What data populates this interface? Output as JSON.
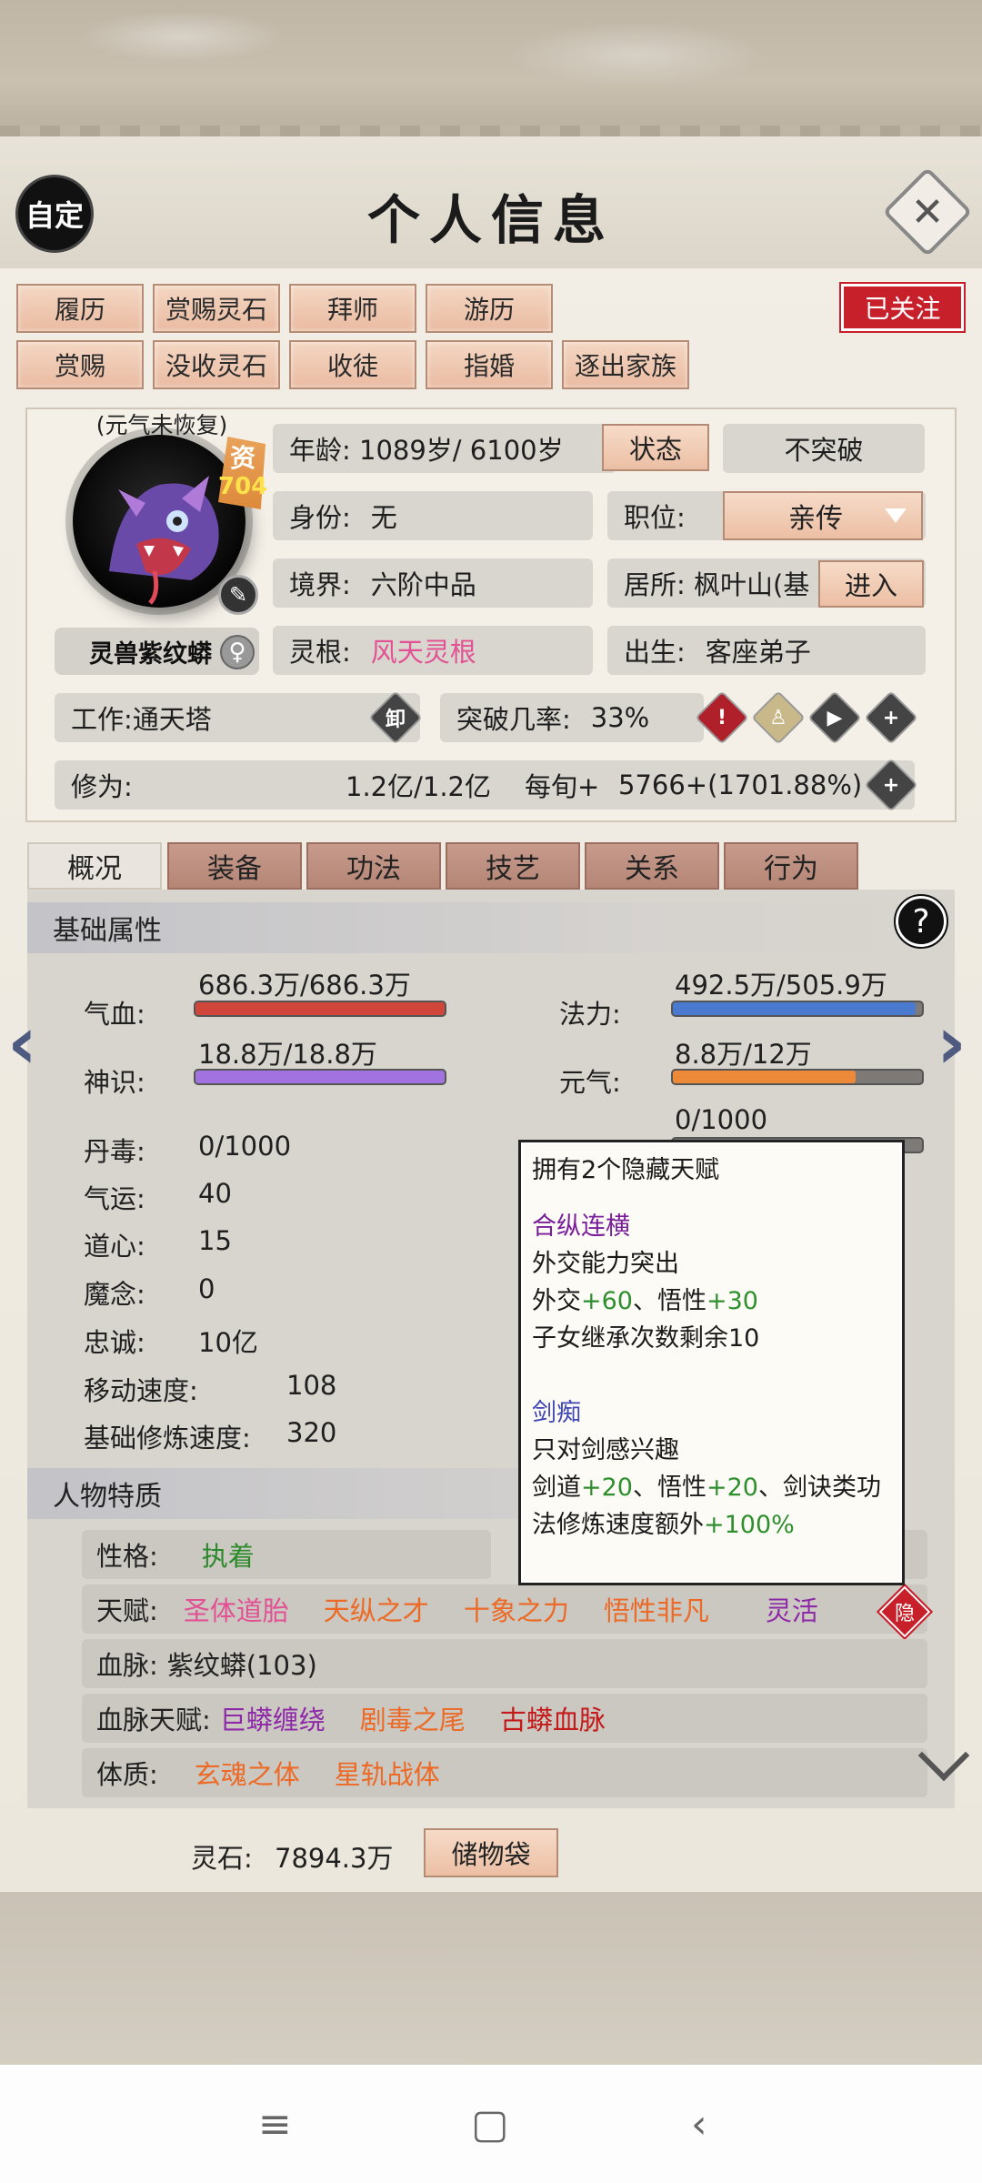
{
  "header": {
    "self_btn": "自定",
    "title": "个人信息"
  },
  "actions_row1": [
    "履历",
    "赏赐灵石",
    "拜师",
    "游历"
  ],
  "actions_row2": [
    "赏赐",
    "没收灵石",
    "收徒",
    "指婚",
    "逐出家族"
  ],
  "followed": "已关注",
  "profile": {
    "status_note": "(元气未恢复)",
    "aptitude_label": "资",
    "aptitude_value": "704",
    "beast_name": "灵兽紫纹蟒",
    "age_label": "年龄:",
    "age_value": "1089岁/ 6100岁",
    "state_btn": "状态",
    "no_breakthrough": "不突破",
    "identity_label": "身份:",
    "identity_value": "无",
    "position_label": "职位:",
    "position_value": "亲传",
    "realm_label": "境界:",
    "realm_value": "六阶中品",
    "residence_label": "居所:",
    "residence_value": "枫叶山(基",
    "enter_btn": "进入",
    "root_label": "灵根:",
    "root_value": "风天灵根",
    "birth_label": "出生:",
    "birth_value": "客座弟子",
    "job_label": "工作:",
    "job_value": "通天塔",
    "unload_label": "卸",
    "bt_rate_label": "突破几率:",
    "bt_rate_value": "33%",
    "cultivation_label": "修为:",
    "cultivation_value": "1.2亿/1.2亿",
    "per_turn_label": "每旬+",
    "per_turn_value": "5766+(1701.88%)"
  },
  "tabs": [
    "概况",
    "装备",
    "功法",
    "技艺",
    "关系",
    "行为"
  ],
  "basic": {
    "title": "基础属性",
    "help": "?",
    "hp_label": "气血:",
    "hp_value": "686.3万/686.3万",
    "hp_fill": 1.0,
    "mana_label": "法力:",
    "mana_value": "492.5万/505.9万",
    "mana_fill": 0.973,
    "sense_label": "神识:",
    "sense_value": "18.8万/18.8万",
    "sense_fill": 1.0,
    "vital_label": "元气:",
    "vital_value": "8.8万/12万",
    "vital_fill": 0.733,
    "third_value": "0/1000",
    "third_fill": 0,
    "stats": [
      {
        "label": "丹毒:",
        "value": "0/1000"
      },
      {
        "label": "气运:",
        "value": "40"
      },
      {
        "label": "道心:",
        "value": "15"
      },
      {
        "label": "魔念:",
        "value": "0"
      },
      {
        "label": "忠诚:",
        "value": "10亿"
      },
      {
        "label": "移动速度:",
        "value": "108"
      },
      {
        "label": "基础修炼速度:",
        "value": "320"
      }
    ],
    "colors": {
      "hp": "#d0463b",
      "mana": "#4a79d0",
      "sense": "#a073e0",
      "vital": "#ec8a3a"
    }
  },
  "traits": {
    "title": "人物特质",
    "personality_label": "性格:",
    "personality_value": "执着",
    "talent_label": "天赋:",
    "talents": [
      "圣体道胎",
      "天纵之才",
      "十象之力",
      "悟性非凡",
      "灵活"
    ],
    "hidden_badge": "隐",
    "bloodline_label": "血脉:",
    "bloodline_value": "紫纹蟒(103)",
    "bl_talent_label": "血脉天赋:",
    "bl_talents": [
      "巨蟒缠绕",
      "剧毒之尾",
      "古蟒血脉"
    ],
    "physique_label": "体质:",
    "physiques": [
      "玄魂之体",
      "星轨战体"
    ]
  },
  "tooltip": {
    "title": "拥有2个隐藏天赋",
    "t1_name": "合纵连横",
    "t1_desc": "外交能力突出",
    "t1_effect_a": "外交",
    "t1_effect_a_val": "+60",
    "t1_effect_sep": "、悟性",
    "t1_effect_b_val": "+30",
    "t1_note": "子女继承次数剩余10",
    "t2_name": "剑痴",
    "t2_desc": "只对剑感兴趣",
    "t2_e1": "剑道",
    "t2_e1_val": "+20",
    "t2_e2": "、悟性",
    "t2_e2_val": "+20",
    "t2_e3": "、剑诀类功",
    "t2_e4": "法修炼速度额外",
    "t2_e4_val": "+100%"
  },
  "footer": {
    "stone_label": "灵石:",
    "stone_value": "7894.3万",
    "bag_btn": "储物袋"
  }
}
